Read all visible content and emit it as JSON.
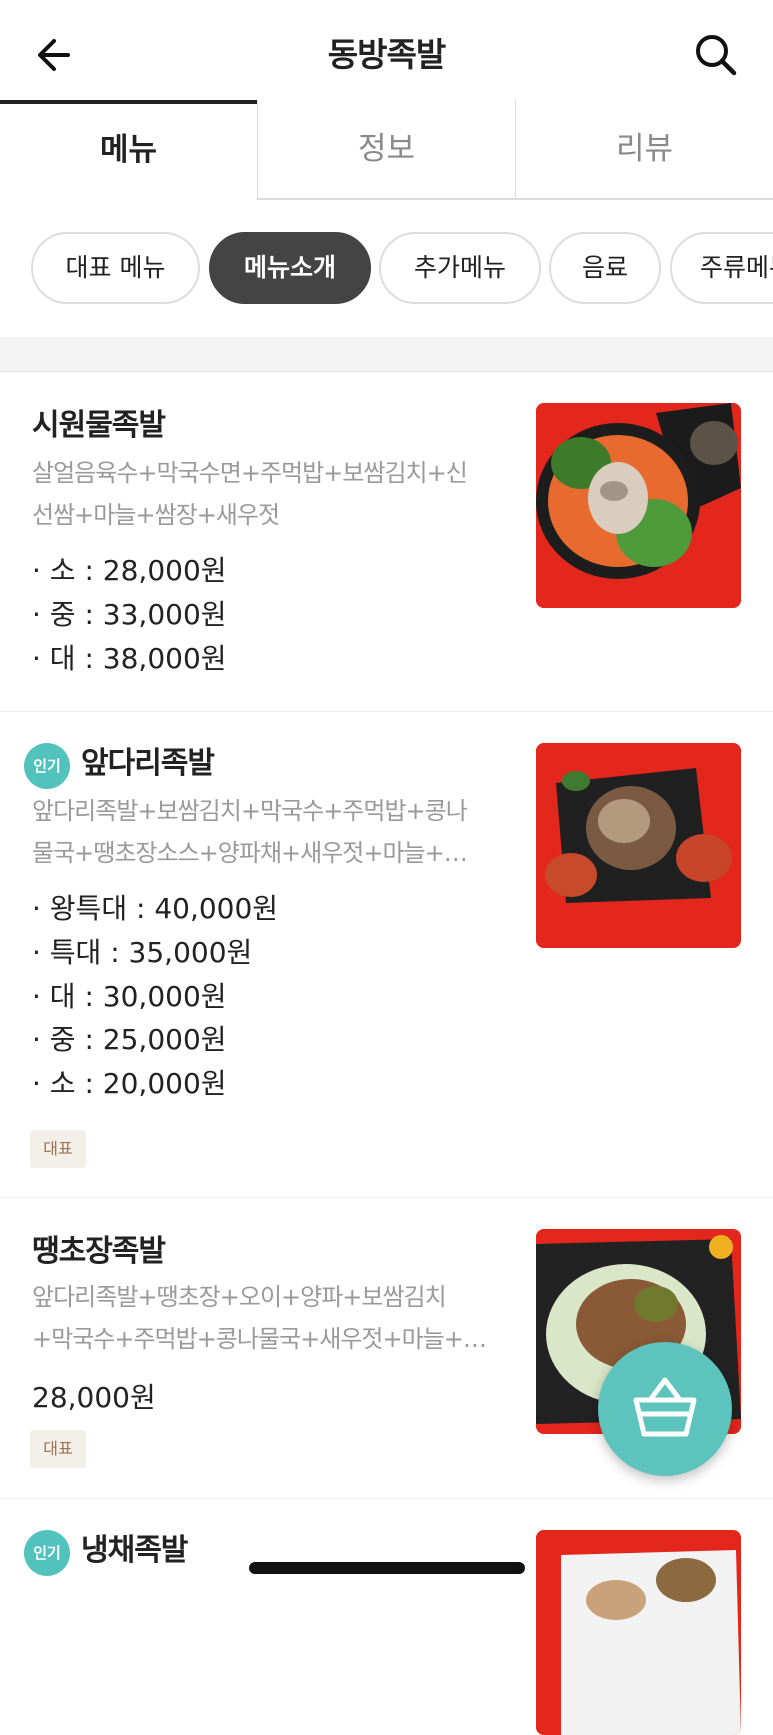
{
  "header": {
    "title": "동방족발",
    "back_icon": "back-arrow-icon",
    "search_icon": "search-icon"
  },
  "tabs": [
    {
      "label": "메뉴"
    },
    {
      "label": "정보"
    },
    {
      "label": "리뷰"
    }
  ],
  "chips": [
    {
      "label": "대표 메뉴"
    },
    {
      "label": "메뉴소개"
    },
    {
      "label": "추가메뉴"
    },
    {
      "label": "음료"
    },
    {
      "label": "주류메뉴"
    }
  ],
  "items": [
    {
      "name": "시원물족발",
      "desc1": "살얼음육수+막국수면+주먹밥+보쌈김치+신",
      "desc2": "선쌈+마늘+쌈장+새우젓",
      "prices": [
        "· 소 : 28,000원",
        "· 중 : 33,000원",
        "· 대 : 38,000원"
      ]
    },
    {
      "badge": "인기",
      "name": "앞다리족발",
      "desc1": "앞다리족발+보쌈김치+막국수+주먹밥+콩나",
      "desc2": "물국+땡초장소스+양파채+새우젓+마늘+…",
      "prices": [
        "· 왕특대 : 40,000원",
        "· 특대 : 35,000원",
        "· 대 : 30,000원",
        "· 중 : 25,000원",
        "· 소 : 20,000원"
      ],
      "tag": "대표"
    },
    {
      "name": "땡초장족발",
      "desc1": "앞다리족발+땡초장+오이+양파+보쌈김치",
      "desc2": "+막국수+주먹밥+콩나물국+새우젓+마늘+…",
      "price": "28,000원",
      "tag": "대표"
    },
    {
      "badge": "인기",
      "name": "냉채족발"
    }
  ],
  "fab_icon": "shopping-basket-icon",
  "colors": {
    "accent": "#5cc3bd",
    "selected_chip": "#444444",
    "tag_bg": "#f3efe9",
    "tag_text": "#a0724f"
  }
}
